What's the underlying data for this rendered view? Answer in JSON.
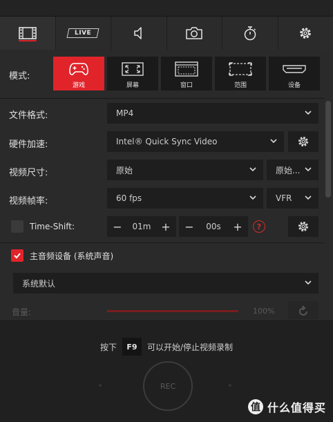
{
  "tabs": [
    {
      "name": "video-record",
      "icon": "film-icon",
      "active": true
    },
    {
      "name": "live",
      "icon": "live-icon",
      "label": "LIVE"
    },
    {
      "name": "audio",
      "icon": "speaker-icon"
    },
    {
      "name": "screenshot",
      "icon": "camera-icon"
    },
    {
      "name": "timer",
      "icon": "stopwatch-icon"
    },
    {
      "name": "settings",
      "icon": "gear-icon"
    }
  ],
  "mode": {
    "label": "模式:",
    "options": [
      {
        "id": "game",
        "label": "游戏",
        "icon": "gamepad-icon",
        "active": true
      },
      {
        "id": "screen",
        "label": "屏幕",
        "icon": "fullscreen-icon"
      },
      {
        "id": "window",
        "label": "窗口",
        "icon": "window-icon"
      },
      {
        "id": "region",
        "label": "范围",
        "icon": "region-icon"
      },
      {
        "id": "device",
        "label": "设备",
        "icon": "hdmi-icon"
      }
    ]
  },
  "settings": {
    "file_format": {
      "label": "文件格式:",
      "value": "MP4"
    },
    "hw_accel": {
      "label": "硬件加速:",
      "value": "Intel® Quick Sync Video"
    },
    "video_size": {
      "label": "视频尺寸:",
      "value": "原始",
      "secondary": "原始..."
    },
    "frame_rate": {
      "label": "视频帧率:",
      "value": "60 fps",
      "secondary": "VFR"
    },
    "time_shift": {
      "label": "Time-Shift:",
      "minutes": "01m",
      "seconds": "00s",
      "checked": false
    },
    "main_audio": {
      "label": "主音频设备 (系统声音)",
      "checked": true,
      "device": "系统默认"
    },
    "volume": {
      "label": "音量:",
      "value": "100%",
      "level": 1.0
    }
  },
  "bottom": {
    "hint_prefix": "按下",
    "hotkey": "F9",
    "hint_suffix": "可以开始/停止视频录制",
    "rec_label": "REC"
  },
  "watermark": {
    "logo": "值",
    "text": "什么值得买"
  },
  "colors": {
    "accent": "#e0242a",
    "background": "#2a2a2a",
    "field": "#1e1e1e"
  }
}
